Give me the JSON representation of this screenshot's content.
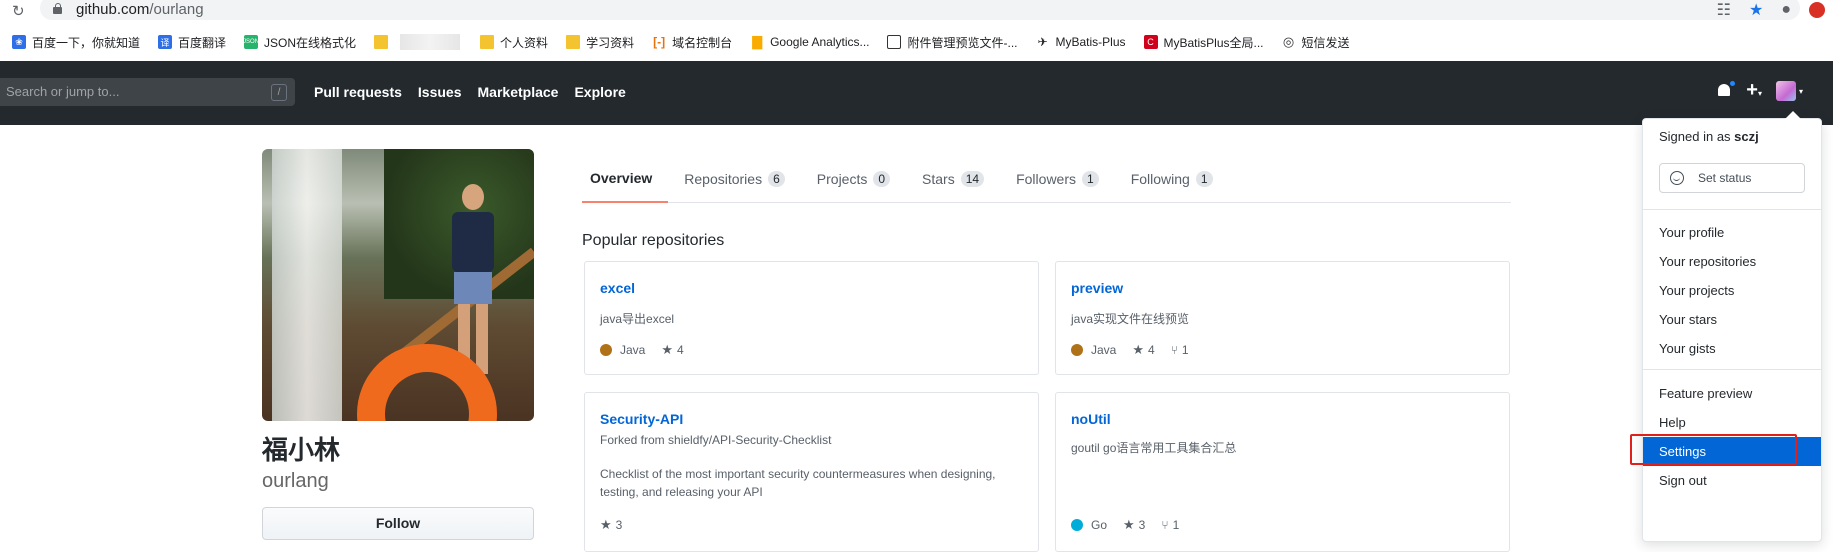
{
  "browser": {
    "url_host": "github.com",
    "url_path": "/ourlang",
    "bookmarks": [
      {
        "label": "百度一下，你就知道",
        "icon": "baidu-icon"
      },
      {
        "label": "百度翻译",
        "icon": "translate-icon"
      },
      {
        "label": "JSON在线格式化",
        "icon": "json-icon"
      },
      {
        "label": "",
        "icon": "folder-icon"
      },
      {
        "label": "个人资料",
        "icon": "folder-icon"
      },
      {
        "label": "学习资料",
        "icon": "folder-icon"
      },
      {
        "label": "域名控制台",
        "icon": "aliyun-icon"
      },
      {
        "label": "Google Analytics...",
        "icon": "analytics-icon"
      },
      {
        "label": "附件管理预览文件-...",
        "icon": "document-icon"
      },
      {
        "label": "MyBatis-Plus",
        "icon": "bird-icon"
      },
      {
        "label": "MyBatisPlus全局...",
        "icon": "c-logo-icon"
      },
      {
        "label": "短信发送",
        "icon": "globe-icon"
      }
    ]
  },
  "header": {
    "search_placeholder": "Search or jump to...",
    "search_shortcut": "/",
    "nav": [
      "Pull requests",
      "Issues",
      "Marketplace",
      "Explore"
    ]
  },
  "profile": {
    "full_name": "福小林",
    "username": "ourlang",
    "follow_label": "Follow"
  },
  "tabs": [
    {
      "label": "Overview",
      "count": null,
      "active": true
    },
    {
      "label": "Repositories",
      "count": "6"
    },
    {
      "label": "Projects",
      "count": "0"
    },
    {
      "label": "Stars",
      "count": "14"
    },
    {
      "label": "Followers",
      "count": "1"
    },
    {
      "label": "Following",
      "count": "1"
    }
  ],
  "popular_title": "Popular repositories",
  "repos": [
    {
      "name": "excel",
      "forked": "",
      "desc": "java导出excel",
      "lang": "Java",
      "lang_color": "#b07219",
      "stars": "4",
      "forks": ""
    },
    {
      "name": "preview",
      "forked": "",
      "desc": "java实现文件在线预览",
      "lang": "Java",
      "lang_color": "#b07219",
      "stars": "4",
      "forks": "1"
    },
    {
      "name": "Security-API",
      "forked": "Forked from shieldfy/API-Security-Checklist",
      "desc": "Checklist of the most important security countermeasures when designing, testing, and releasing your API",
      "lang": "",
      "lang_color": "",
      "stars": "3",
      "forks": ""
    },
    {
      "name": "noUtil",
      "forked": "",
      "desc": "goutil go语言常用工具集合汇总",
      "lang": "Go",
      "lang_color": "#00ADD8",
      "stars": "3",
      "forks": "1"
    }
  ],
  "dropdown": {
    "signed_prefix": "Signed in as ",
    "signed_user": "sczj",
    "set_status": "Set status",
    "group1": [
      "Your profile",
      "Your repositories",
      "Your projects",
      "Your stars",
      "Your gists"
    ],
    "group2": [
      "Feature preview",
      "Help",
      "Settings",
      "Sign out"
    ],
    "highlighted": "Settings"
  },
  "colors": {
    "header_bg": "#24292e",
    "link": "#0366d6",
    "tab_active_underline": "#f9826c",
    "highlight": "#0366d6",
    "annotation_red": "#e0201b"
  }
}
